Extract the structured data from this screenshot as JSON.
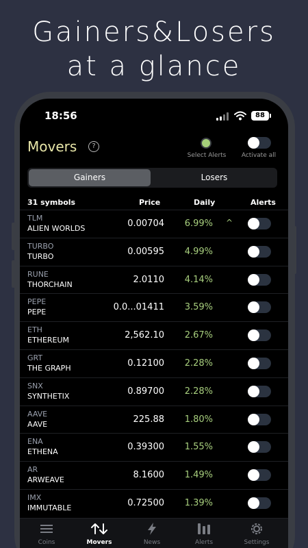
{
  "headline": {
    "line1": "Gainers&Losers",
    "line2": "at a glance"
  },
  "status_bar": {
    "time": "18:56",
    "battery": "88"
  },
  "header": {
    "title": "Movers",
    "help_icon": "question-circle-icon",
    "select_alerts": "Select Alerts",
    "activate_all": "Activate all"
  },
  "segments": {
    "gainers": "Gainers",
    "losers": "Losers",
    "selected": "Gainers"
  },
  "table": {
    "headers": {
      "count": "31 symbols",
      "price": "Price",
      "daily": "Daily",
      "alerts": "Alerts"
    },
    "rows": [
      {
        "symbol": "TLM",
        "name": "ALIEN WORLDS",
        "price": "0.00704",
        "daily": "6.99%",
        "expanded": true
      },
      {
        "symbol": "TURBO",
        "name": "TURBO",
        "price": "0.00595",
        "daily": "4.99%"
      },
      {
        "symbol": "RUNE",
        "name": "THORCHAIN",
        "price": "2.0110",
        "daily": "4.14%"
      },
      {
        "symbol": "PEPE",
        "name": "PEPE",
        "price": "0.0...01411",
        "daily": "3.59%"
      },
      {
        "symbol": "ETH",
        "name": "ETHEREUM",
        "price": "2,562.10",
        "daily": "2.67%"
      },
      {
        "symbol": "GRT",
        "name": "THE GRAPH",
        "price": "0.12100",
        "daily": "2.28%"
      },
      {
        "symbol": "SNX",
        "name": "SYNTHETIX",
        "price": "0.89700",
        "daily": "2.28%"
      },
      {
        "symbol": "AAVE",
        "name": "AAVE",
        "price": "225.88",
        "daily": "1.80%"
      },
      {
        "symbol": "ENA",
        "name": "ETHENA",
        "price": "0.39300",
        "daily": "1.55%"
      },
      {
        "symbol": "AR",
        "name": "ARWEAVE",
        "price": "8.1600",
        "daily": "1.49%"
      },
      {
        "symbol": "IMX",
        "name": "IMMUTABLE",
        "price": "0.72500",
        "daily": "1.39%"
      }
    ]
  },
  "tabs": [
    {
      "label": "Coins",
      "icon": "menu-icon"
    },
    {
      "label": "Movers",
      "icon": "up-down-arrows-icon",
      "active": true
    },
    {
      "label": "News",
      "icon": "lightning-icon"
    },
    {
      "label": "Alerts",
      "icon": "bars-icon"
    },
    {
      "label": "Settings",
      "icon": "gear-icon"
    }
  ],
  "colors": {
    "background": "#2d3142",
    "title": "#e8e6a8",
    "positive": "#a8cf7e",
    "selected_segment": "#5b5e63"
  }
}
